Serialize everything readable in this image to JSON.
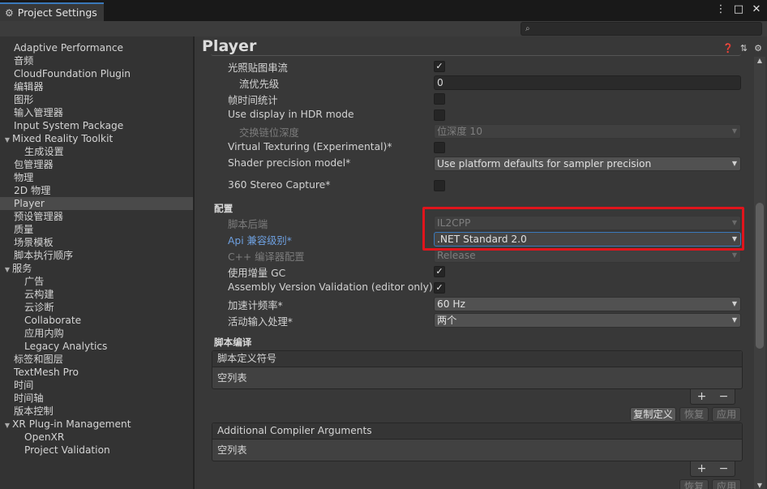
{
  "window": {
    "tab_title": "Project Settings",
    "menu_icon": "⋮",
    "maximize_icon": "□",
    "close_icon": "✕"
  },
  "search": {
    "placeholder": "",
    "icon": "🔍︎"
  },
  "sidebar": {
    "items": [
      {
        "label": "Adaptive Performance",
        "indent": 0
      },
      {
        "label": "音频",
        "indent": 0
      },
      {
        "label": "CloudFoundation Plugin",
        "indent": 0
      },
      {
        "label": "编辑器",
        "indent": 0
      },
      {
        "label": "图形",
        "indent": 0
      },
      {
        "label": "输入管理器",
        "indent": 0
      },
      {
        "label": "Input System Package",
        "indent": 0
      },
      {
        "label": "Mixed Reality Toolkit",
        "indent": 0,
        "expanded": true
      },
      {
        "label": "生成设置",
        "indent": 1
      },
      {
        "label": "包管理器",
        "indent": 0
      },
      {
        "label": "物理",
        "indent": 0
      },
      {
        "label": "2D 物理",
        "indent": 0
      },
      {
        "label": "Player",
        "indent": 0,
        "selected": true
      },
      {
        "label": "预设管理器",
        "indent": 0
      },
      {
        "label": "质量",
        "indent": 0
      },
      {
        "label": "场景模板",
        "indent": 0
      },
      {
        "label": "脚本执行顺序",
        "indent": 0
      },
      {
        "label": "服务",
        "indent": 0,
        "expanded": true
      },
      {
        "label": "广告",
        "indent": 1
      },
      {
        "label": "云构建",
        "indent": 1
      },
      {
        "label": "云诊断",
        "indent": 1
      },
      {
        "label": "Collaborate",
        "indent": 1
      },
      {
        "label": "应用内购",
        "indent": 1
      },
      {
        "label": "Legacy Analytics",
        "indent": 1
      },
      {
        "label": "标签和图层",
        "indent": 0
      },
      {
        "label": "TextMesh Pro",
        "indent": 0
      },
      {
        "label": "时间",
        "indent": 0
      },
      {
        "label": "时间轴",
        "indent": 0
      },
      {
        "label": "版本控制",
        "indent": 0
      },
      {
        "label": "XR Plug-in Management",
        "indent": 0,
        "expanded": true
      },
      {
        "label": "OpenXR",
        "indent": 1
      },
      {
        "label": "Project Validation",
        "indent": 1
      }
    ]
  },
  "main": {
    "title": "Player",
    "header_icons": [
      "❓",
      "⇄",
      "⚙"
    ],
    "rows": {
      "lightmap_streaming": {
        "label": "光照贴图串流",
        "checked": true,
        "check": "✓"
      },
      "streaming_priority": {
        "label": "流优先级",
        "value": "0"
      },
      "frame_timing": {
        "label": "帧时间统计"
      },
      "hdr_display": {
        "label": "Use display in HDR mode"
      },
      "swap_chain_depth": {
        "label": "交换链位深度",
        "value": "位深度 10"
      },
      "virtual_texturing": {
        "label": "Virtual Texturing (Experimental)*"
      },
      "shader_precision": {
        "label": "Shader precision model*",
        "value": "Use platform defaults for sampler precision"
      },
      "stereo_capture": {
        "label": "360 Stereo Capture*"
      },
      "config_section": "配置",
      "scripting_backend": {
        "label": "脚本后端",
        "value": "IL2CPP"
      },
      "api_compat": {
        "label": "Api 兼容级别*",
        "value": ".NET Standard 2.0"
      },
      "cpp_compiler": {
        "label": "C++ 编译器配置",
        "value": "Release"
      },
      "incremental_gc": {
        "label": "使用增量 GC",
        "check": "✓"
      },
      "assembly_validation": {
        "label": "Assembly Version Validation (editor only)",
        "check": "✓"
      },
      "accelerometer": {
        "label": "加速计频率*",
        "value": "60 Hz"
      },
      "active_input": {
        "label": "活动输入处理*",
        "value": "两个"
      },
      "script_compile_section": "脚本编译"
    },
    "define_symbols": {
      "header": "脚本定义符号",
      "empty": "空列表",
      "plus": "+",
      "minus": "−",
      "copy_btn": "复制定义",
      "revert_btn": "恢复",
      "apply_btn": "应用"
    },
    "compiler_args": {
      "header": "Additional Compiler Arguments",
      "empty": "空列表",
      "plus": "+",
      "minus": "−",
      "revert_btn": "恢复",
      "apply_btn": "应用"
    },
    "caret": "▼"
  },
  "scrollbar": {
    "up": "▲",
    "down": "▼"
  },
  "colors": {
    "accent": "#3a79bb",
    "highlight_box": "#e0141c",
    "selected_item": "#4a4a4a"
  }
}
